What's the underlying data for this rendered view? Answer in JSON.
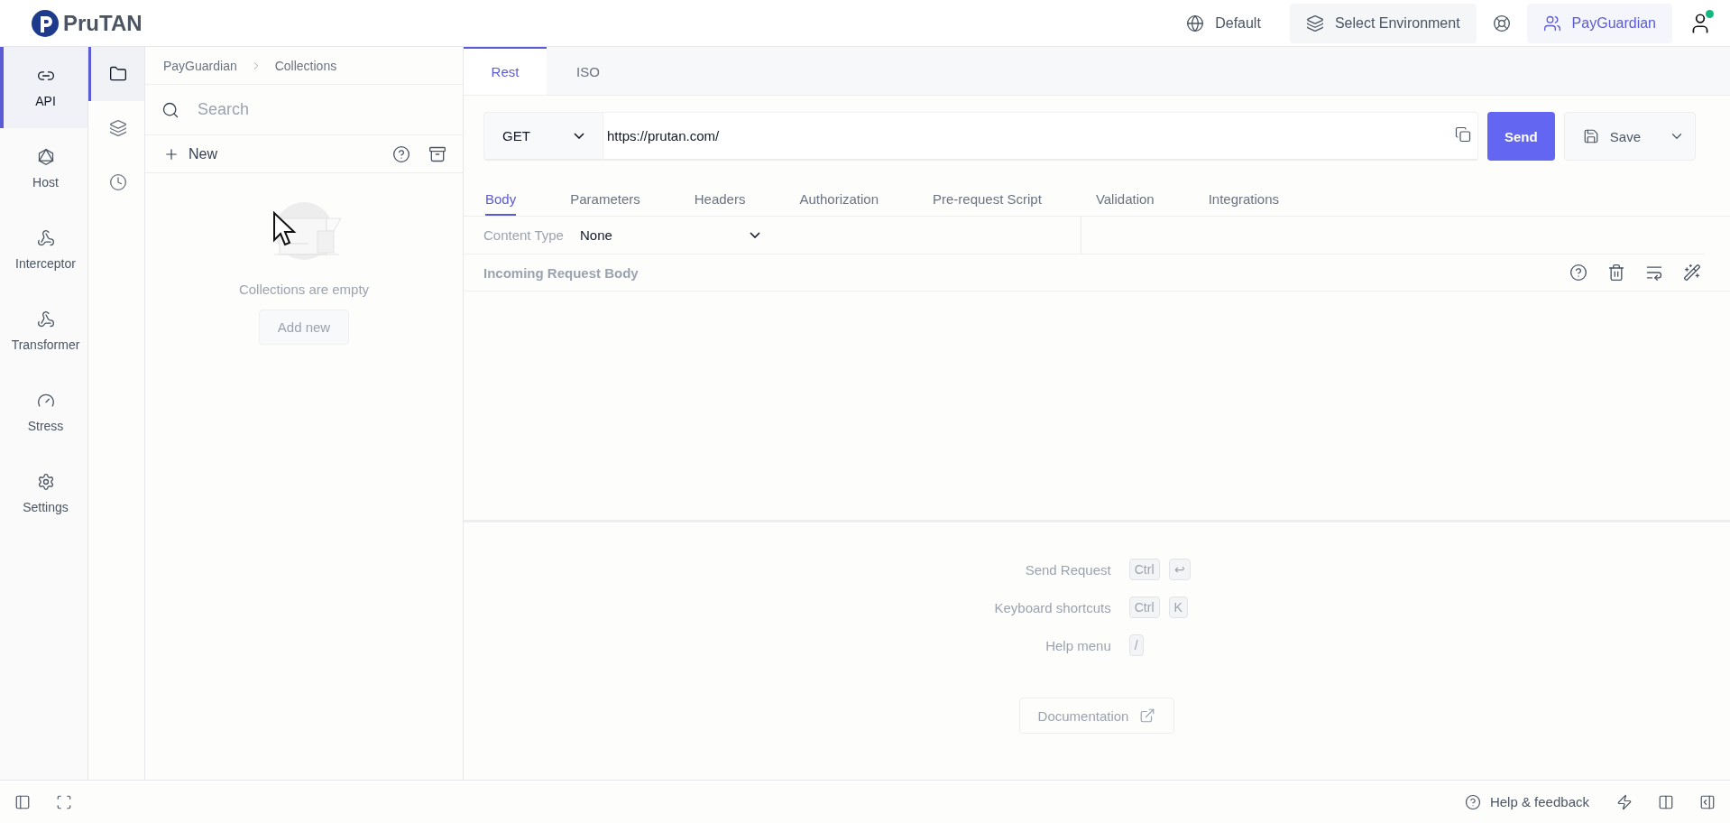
{
  "header": {
    "logo": "PruTAN",
    "workspace": "Default",
    "environment": "Select Environment",
    "team": "PayGuardian",
    "user_online": true
  },
  "nav": [
    {
      "label": "API",
      "selected": true
    },
    {
      "label": "Host",
      "selected": false
    },
    {
      "label": "Interceptor",
      "selected": false
    },
    {
      "label": "Transformer",
      "selected": false
    },
    {
      "label": "Stress",
      "selected": false
    },
    {
      "label": "Settings",
      "selected": false
    }
  ],
  "rail": [
    {
      "selected": true
    },
    {
      "selected": false
    },
    {
      "selected": false
    }
  ],
  "collections": {
    "breadcrumb": [
      "PayGuardian",
      "Collections"
    ],
    "search_placeholder": "Search",
    "new_label": "New",
    "empty_text": "Collections are empty",
    "add_button": "Add new"
  },
  "request_tabs": [
    {
      "label": "Rest",
      "selected": true
    },
    {
      "label": "ISO",
      "selected": false
    }
  ],
  "request": {
    "method": "GET",
    "url": "https://prutan.com/",
    "send": "Send",
    "save": "Save"
  },
  "section_tabs": [
    {
      "label": "Body",
      "selected": true
    },
    {
      "label": "Parameters",
      "selected": false
    },
    {
      "label": "Headers",
      "selected": false
    },
    {
      "label": "Authorization",
      "selected": false
    },
    {
      "label": "Pre-request Script",
      "selected": false
    },
    {
      "label": "Validation",
      "selected": false
    },
    {
      "label": "Integrations",
      "selected": false
    }
  ],
  "content_type": {
    "label": "Content Type",
    "value": "None"
  },
  "body": {
    "title": "Incoming Request Body"
  },
  "shortcuts": [
    {
      "label": "Send Request",
      "keys": [
        "Ctrl",
        "↩"
      ]
    },
    {
      "label": "Keyboard shortcuts",
      "keys": [
        "Ctrl",
        "K"
      ]
    },
    {
      "label": "Help menu",
      "keys": [
        "/"
      ]
    }
  ],
  "documentation": "Documentation",
  "status_bar": {
    "help": "Help & feedback"
  }
}
